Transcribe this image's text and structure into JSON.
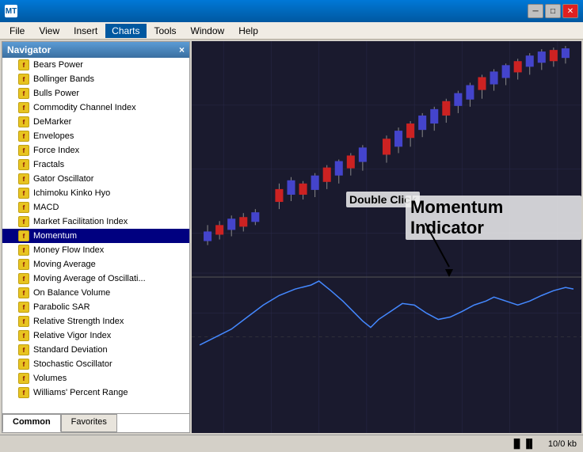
{
  "titleBar": {
    "appIcon": "MT",
    "title": "",
    "minBtn": "─",
    "maxBtn": "□",
    "closeBtn": "✕"
  },
  "menuBar": {
    "items": [
      "File",
      "View",
      "Insert",
      "Charts",
      "Tools",
      "Window",
      "Help"
    ],
    "activeItem": "Charts"
  },
  "navigator": {
    "title": "Navigator",
    "closeBtn": "×",
    "items": [
      {
        "label": "Bears Power",
        "icon": "f"
      },
      {
        "label": "Bollinger Bands",
        "icon": "f"
      },
      {
        "label": "Bulls Power",
        "icon": "f"
      },
      {
        "label": "Commodity Channel Index",
        "icon": "f"
      },
      {
        "label": "DeMarker",
        "icon": "f"
      },
      {
        "label": "Envelopes",
        "icon": "f"
      },
      {
        "label": "Force Index",
        "icon": "f"
      },
      {
        "label": "Fractals",
        "icon": "f"
      },
      {
        "label": "Gator Oscillator",
        "icon": "f"
      },
      {
        "label": "Ichimoku Kinko Hyo",
        "icon": "f"
      },
      {
        "label": "MACD",
        "icon": "f"
      },
      {
        "label": "Market Facilitation Index",
        "icon": "f"
      },
      {
        "label": "Momentum",
        "icon": "f",
        "selected": true
      },
      {
        "label": "Money Flow Index",
        "icon": "f"
      },
      {
        "label": "Moving Average",
        "icon": "f"
      },
      {
        "label": "Moving Average of Oscillati...",
        "icon": "f"
      },
      {
        "label": "On Balance Volume",
        "icon": "f"
      },
      {
        "label": "Parabolic SAR",
        "icon": "f"
      },
      {
        "label": "Relative Strength Index",
        "icon": "f"
      },
      {
        "label": "Relative Vigor Index",
        "icon": "f"
      },
      {
        "label": "Standard Deviation",
        "icon": "f"
      },
      {
        "label": "Stochastic Oscillator",
        "icon": "f"
      },
      {
        "label": "Volumes",
        "icon": "f"
      },
      {
        "label": "Williams' Percent Range",
        "icon": "f"
      }
    ],
    "tabs": [
      {
        "label": "Common",
        "active": true
      },
      {
        "label": "Favorites",
        "active": false
      }
    ]
  },
  "chartLabels": {
    "doubleClick": "Double Click",
    "momentumIndicator": "Momentum Indicator"
  },
  "statusBar": {
    "icon": "▐▌▐▌",
    "sizeInfo": "10/0 kb"
  }
}
